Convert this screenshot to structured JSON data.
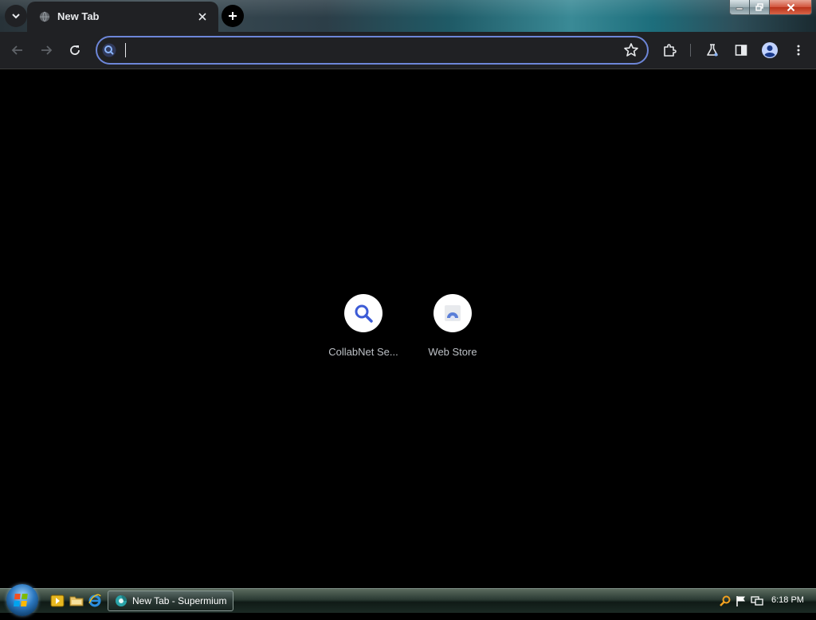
{
  "browser": {
    "tab": {
      "title": "New Tab"
    },
    "omnibox": {
      "value": "",
      "placeholder": ""
    }
  },
  "new_tab_page": {
    "shortcuts": [
      {
        "label": "CollabNet Se...",
        "icon": "search-icon"
      },
      {
        "label": "Web Store",
        "icon": "web-store-icon"
      }
    ]
  },
  "taskbar": {
    "window_button_label": "New Tab - Supermium",
    "clock": "6:18 PM"
  },
  "colors": {
    "toolbar_bg": "#202124",
    "omnibox_focus_border": "#6d86d8",
    "accent_blue": "#3c5bd6",
    "page_bg": "#000000"
  }
}
